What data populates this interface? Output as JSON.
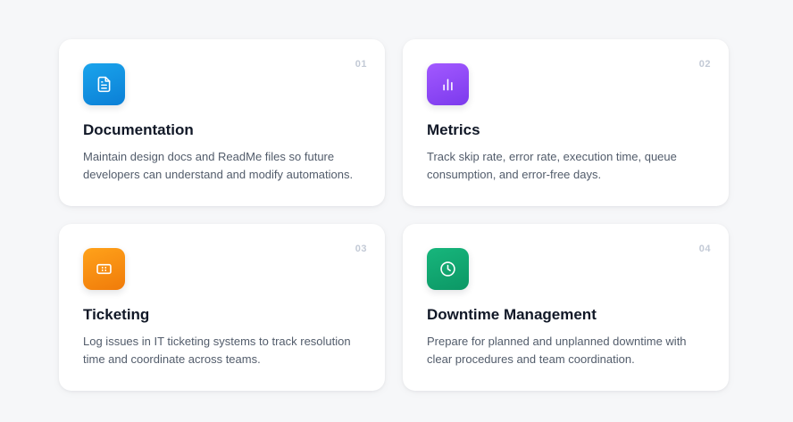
{
  "cards": [
    {
      "number": "01",
      "icon": "document-icon",
      "color": "#0b8fe0",
      "title": "Documentation",
      "description": "Maintain design docs and ReadMe files so future developers can understand and modify automations."
    },
    {
      "number": "02",
      "icon": "bar-chart-icon",
      "color": "#8b47f5",
      "title": "Metrics",
      "description": "Track skip rate, error rate, execution time, queue consumption, and error-free days."
    },
    {
      "number": "03",
      "icon": "ticket-icon",
      "color": "#f68c12",
      "title": "Ticketing",
      "description": "Log issues in IT ticketing systems to track resolution time and coordinate across teams."
    },
    {
      "number": "04",
      "icon": "clock-icon",
      "color": "#10a870",
      "title": "Downtime Management",
      "description": "Prepare for planned and unplanned downtime with clear procedures and team coordination."
    }
  ]
}
